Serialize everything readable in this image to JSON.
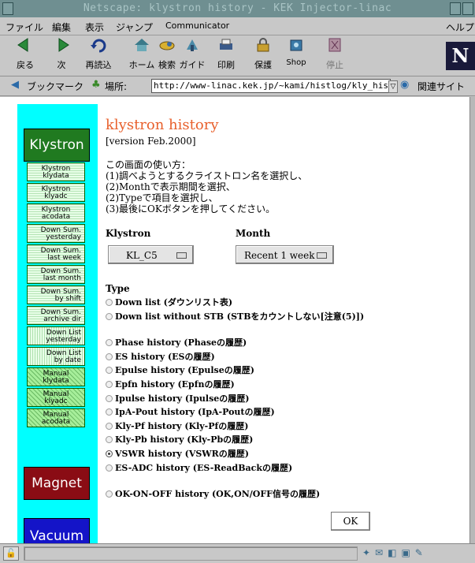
{
  "window": {
    "title": "Netscape: klystron history - KEK Injector-linac"
  },
  "menubar": {
    "items": [
      "ファイル",
      "編集",
      "表示",
      "ジャンプ",
      "Communicator"
    ],
    "help": "ヘルプ"
  },
  "toolbar": {
    "buttons": [
      {
        "label": "戻る",
        "icon": "back-arrow-icon"
      },
      {
        "label": "次",
        "icon": "forward-arrow-icon"
      },
      {
        "label": "再読込",
        "icon": "reload-icon"
      },
      {
        "label": "ホーム",
        "icon": "home-icon"
      },
      {
        "label": "検索",
        "icon": "search-icon"
      },
      {
        "label": "ガイド",
        "icon": "guide-icon"
      },
      {
        "label": "印刷",
        "icon": "print-icon"
      },
      {
        "label": "保護",
        "icon": "security-lock-icon"
      },
      {
        "label": "Shop",
        "icon": "shop-icon"
      },
      {
        "label": "停止",
        "icon": "stop-icon"
      }
    ]
  },
  "location": {
    "bookmarks_label": "ブックマーク",
    "location_label": "場所:",
    "url": "http://www-linac.kek.jp/~kami/histlog/kly_history",
    "related_label": "関連サイト"
  },
  "sidebar": {
    "klystron": "Klystron",
    "links": [
      {
        "line1": "Klystron",
        "line2": "klydata",
        "style": "c"
      },
      {
        "line1": "Klystron",
        "line2": "klyadc",
        "style": "c"
      },
      {
        "line1": "Klystron",
        "line2": "acodata",
        "style": "c"
      },
      {
        "line1": "Down Sum.",
        "line2": "yesterday",
        "style": "h"
      },
      {
        "line1": "Down Sum.",
        "line2": "last week",
        "style": "h"
      },
      {
        "line1": "Down Sum.",
        "line2": "last month",
        "style": "h"
      },
      {
        "line1": "Down Sum.",
        "line2": "by shift",
        "style": "h"
      },
      {
        "line1": "Down Sum.",
        "line2": "archive dir",
        "style": "h"
      },
      {
        "line1": "Down List",
        "line2": "yesterday",
        "style": "v"
      },
      {
        "line1": "Down List",
        "line2": "by date",
        "style": "v"
      },
      {
        "line1": "Manual",
        "line2": "klydata",
        "style": "d"
      },
      {
        "line1": "Manual",
        "line2": "klyadc",
        "style": "d"
      },
      {
        "line1": "Manual",
        "line2": "acodata",
        "style": "d"
      }
    ],
    "magnet": "Magnet",
    "vacuum": "Vacuum"
  },
  "main": {
    "title": "klystron history",
    "version": "[version Feb.2000]",
    "instructions": [
      "この画面の使い方：",
      "(1)調べようとするクライストロン名を選択し、",
      "(2)Monthで表示期間を選択、",
      "(2)Typeで項目を選択し、",
      "(3)最後にOKボタンを押してください。"
    ],
    "klystron_label": "Klystron",
    "klystron_value": "KL_C5",
    "month_label": "Month",
    "month_value": "Recent 1 week",
    "type_label": "Type",
    "types": [
      {
        "b": "Down list",
        "t": " (ダウンリスト表)",
        "checked": false
      },
      {
        "b": "Down list without STB",
        "t": " (STBをカウントしない[注意(5)])",
        "checked": false
      },
      {
        "b": "Phase history",
        "t": " (Phaseの履歴)",
        "checked": false,
        "gap": true
      },
      {
        "b": "ES history",
        "t": " (ESの履歴)",
        "checked": false
      },
      {
        "b": "Epulse history",
        "t": " (Epulseの履歴)",
        "checked": false
      },
      {
        "b": "Epfn history",
        "t": " (Epfnの履歴)",
        "checked": false
      },
      {
        "b": "Ipulse history",
        "t": " (Ipulseの履歴)",
        "checked": false
      },
      {
        "b": "IpA-Pout history",
        "t": " (IpA-Poutの履歴)",
        "checked": false
      },
      {
        "b": "Kly-Pf history",
        "t": " (Kly-Pfの履歴)",
        "checked": false
      },
      {
        "b": "Kly-Pb history",
        "t": " (Kly-Pbの履歴)",
        "checked": false
      },
      {
        "b": "VSWR history",
        "t": " (VSWRの履歴)",
        "checked": true
      },
      {
        "b": "ES-ADC history",
        "t": " (ES-ReadBackの履歴)",
        "checked": false
      },
      {
        "b": "OK-ON-OFF history",
        "t": " (OK,ON/OFF信号の履歴)",
        "checked": false,
        "gap": true
      }
    ],
    "ok_label": "OK"
  }
}
